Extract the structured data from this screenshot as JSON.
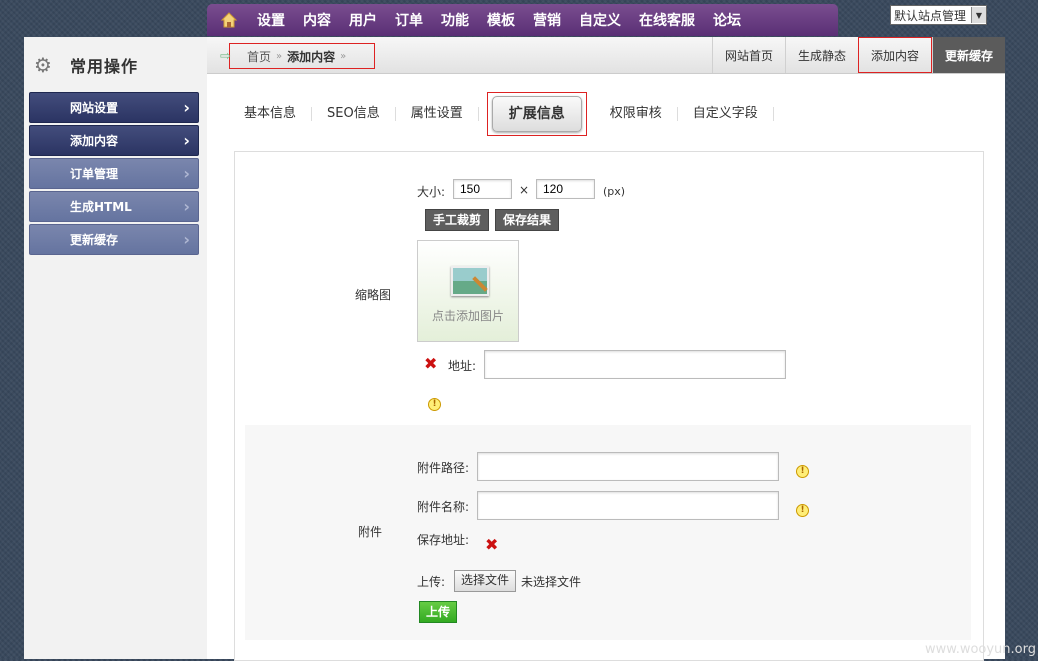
{
  "topnav": {
    "items": [
      "设置",
      "内容",
      "用户",
      "订单",
      "功能",
      "模板",
      "营销",
      "自定义",
      "在线客服",
      "论坛"
    ],
    "site_select": "默认站点管理"
  },
  "sidebar": {
    "title": "常用操作",
    "items": [
      {
        "label": "网站设置"
      },
      {
        "label": "添加内容"
      },
      {
        "label": "订单管理"
      },
      {
        "label": "生成HTML"
      },
      {
        "label": "更新缓存"
      }
    ]
  },
  "breadcrumb": {
    "home": "首页",
    "current": "添加内容"
  },
  "right_buttons": [
    "网站首页",
    "生成静态",
    "添加内容",
    "更新缓存"
  ],
  "tabs": [
    "基本信息",
    "SEO信息",
    "属性设置",
    "扩展信息",
    "权限审核",
    "自定义字段"
  ],
  "thumbnail": {
    "label": "缩略图",
    "size_label": "大小:",
    "width": "150",
    "height": "120",
    "times": "×",
    "unit": "(px)",
    "crop_button": "手工裁剪",
    "save_button": "保存结果",
    "add_image": "点击添加图片",
    "address_label": "地址:",
    "address_value": ""
  },
  "attachment": {
    "label": "附件",
    "path_label": "附件路径:",
    "path_value": "",
    "name_label": "附件名称:",
    "name_value": "",
    "save_label": "保存地址:",
    "upload_label": "上传:",
    "choose_file": "选择文件",
    "no_file": "未选择文件",
    "upload_button": "上传"
  },
  "watermark": "www.wooyun.org"
}
